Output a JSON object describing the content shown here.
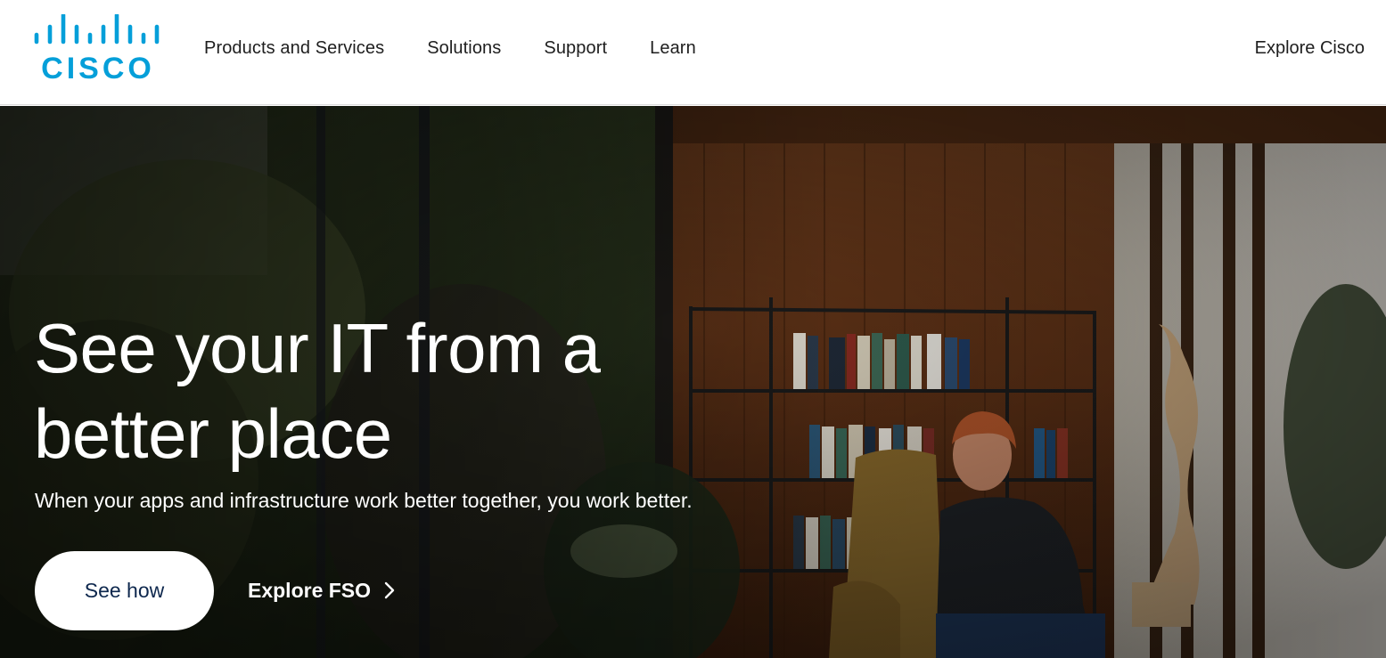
{
  "header": {
    "logo_text": "CISCO",
    "nav": [
      {
        "label": "Products and Services"
      },
      {
        "label": "Solutions"
      },
      {
        "label": "Support"
      },
      {
        "label": "Learn"
      }
    ],
    "explore_label": "Explore Cisco"
  },
  "hero": {
    "headline": "See your IT from a better place",
    "subheadline": "When your apps and infrastructure work better together, you work better.",
    "primary_cta": "See how",
    "secondary_cta": "Explore FSO"
  },
  "colors": {
    "brand_blue": "#049fd9",
    "cta_text": "#0d274d",
    "nav_text": "#1e1e1e",
    "hero_text": "#ffffff"
  },
  "icons": {
    "logo": "cisco-bridge-logo",
    "chevron": "chevron-right-icon"
  }
}
